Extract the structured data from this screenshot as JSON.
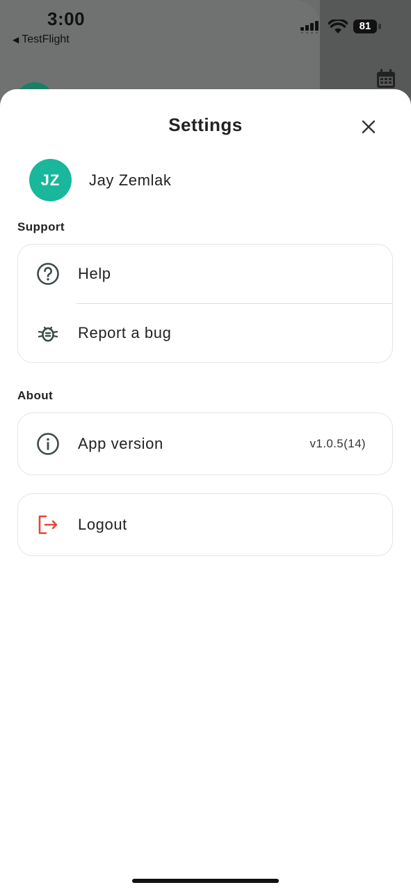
{
  "status_bar": {
    "time": "3:00",
    "back_label": "TestFlight",
    "battery": "81"
  },
  "sheet": {
    "title": "Settings",
    "close_icon": "close-icon"
  },
  "profile": {
    "initials": "JZ",
    "name": "Jay Zemlak",
    "avatar_color": "#19b79b"
  },
  "support": {
    "heading": "Support",
    "items": [
      {
        "label": "Help",
        "icon": "help-circle-icon"
      },
      {
        "label": "Report a bug",
        "icon": "bug-icon"
      }
    ]
  },
  "about": {
    "heading": "About",
    "app_version_label": "App version",
    "app_version_value": "v1.0.5(14)",
    "icon": "info-icon"
  },
  "logout": {
    "label": "Logout",
    "icon": "logout-icon",
    "color": "#e5453a"
  }
}
